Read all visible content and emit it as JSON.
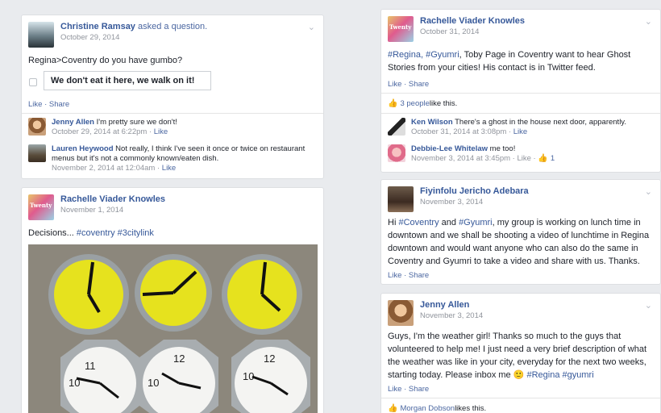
{
  "left_column": {
    "question_post": {
      "author": "Christine Ramsay",
      "action": " asked a question.",
      "date": "October 29, 2014",
      "text": "Regina>Coventry do you have gumbo?",
      "option": "We don't eat it here, we walk on it!",
      "actions": "Like · Share",
      "comments": [
        {
          "name": "Jenny Allen",
          "text": " I'm pretty sure we don't!",
          "meta": "October 29, 2014 at 6:22pm · ",
          "like": "Like"
        },
        {
          "name": "Lauren Heywood",
          "text": " Not really, I think I've seen it once or twice on restaurant menus but it's not a commonly known/eaten dish.",
          "meta": "November 2, 2014 at 12:04am · ",
          "like": "Like"
        }
      ]
    },
    "photo_post": {
      "author": "Rachelle Viader Knowles",
      "date": "November 1, 2014",
      "text": "Decisions... ",
      "hashtags": "#coventry #3citylink"
    }
  },
  "right_column": {
    "post1": {
      "author": "Rachelle Viader Knowles",
      "date": "October 31, 2014",
      "hashtags": "#Regina, #Gyumri",
      "text": ", Toby Page in Coventry want to hear Ghost Stories from your cities! His contact is in Twitter feed.",
      "actions": "Like · Share",
      "likes_count": "3 people",
      "likes_suffix": " like this.",
      "comments": [
        {
          "name": "Ken Wilson",
          "text": " There's a ghost in the house next door, apparently.",
          "meta": "October 31, 2014 at 3:08pm · ",
          "like": "Like"
        },
        {
          "name": "Debbie-Lee Whitelaw",
          "text": " me too!",
          "meta": "November 3, 2014 at 3:45pm · Like · ",
          "like": "1"
        }
      ]
    },
    "post2": {
      "author": "Fiyinfolu Jericho Adebara",
      "date": "November 3, 2014",
      "text_a": "Hi ",
      "tag1": "#Coventry",
      "text_b": " and ",
      "tag2": "#Gyumri",
      "text_c": ", my group is working on lunch time in downtown and we shall be shooting a video of lunchtime in Regina downtown and would want anyone who can also do the same in Coventry and Gyumri to take a video and share with us. Thanks.",
      "actions": "Like · Share"
    },
    "post3": {
      "author": "Jenny Allen",
      "date": "November 3, 2014",
      "text": "Guys, I'm the weather girl! Thanks so much to the guys that volunteered to help me! I just need a very brief description of what the weather was like in your city, everyday for the next two weeks, starting today. Please inbox me ",
      "emoji": "🙂",
      "hashtags": "#Regina #gyumri",
      "actions": "Like · Share",
      "likes_name": "Morgan Dobson",
      "likes_suffix": " likes this."
    }
  },
  "icons": {
    "chevron": "chevron-down-icon",
    "thumb": "thumbs-up-icon"
  },
  "colors": {
    "link": "#365899",
    "meta": "#90949c",
    "clock_yellow": "#e6e21e"
  }
}
